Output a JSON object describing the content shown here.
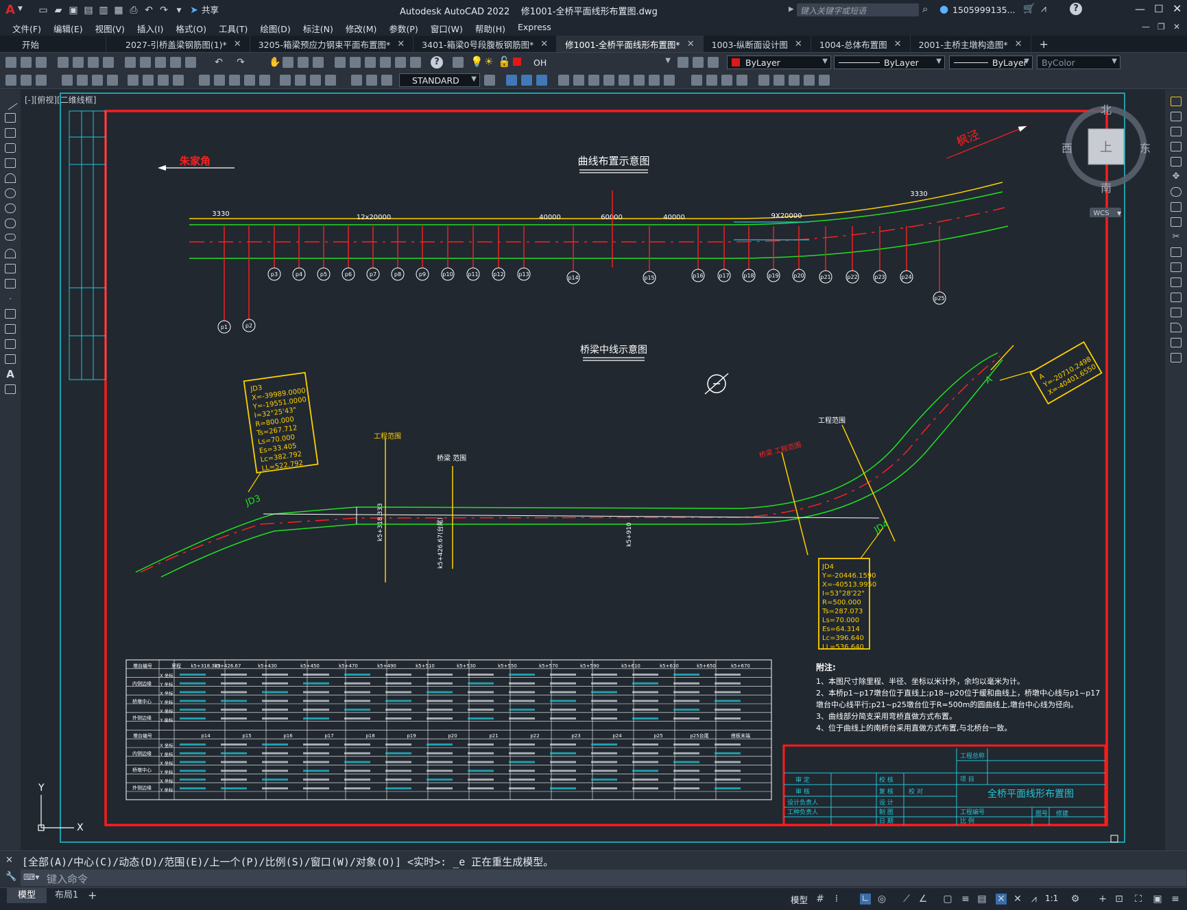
{
  "app": {
    "title": "Autodesk AutoCAD 2022    修1001-全桥平面线形布置图.dwg",
    "share_label": "共享",
    "search_placeholder": "键入关键字或短语",
    "user": "1505999135...",
    "help_icon": "question-icon",
    "window_controls": [
      "minimize-icon",
      "maximize-icon",
      "close-icon"
    ]
  },
  "menu": [
    "文件(F)",
    "编辑(E)",
    "视图(V)",
    "插入(I)",
    "格式(O)",
    "工具(T)",
    "绘图(D)",
    "标注(N)",
    "修改(M)",
    "参数(P)",
    "窗口(W)",
    "帮助(H)",
    "Express"
  ],
  "tabs": [
    {
      "label": "开始",
      "active": false
    },
    {
      "label": "2027-引桥盖梁钢筋图(1)*",
      "active": false
    },
    {
      "label": "3205-箱梁预应力钢束平面布置图*",
      "active": false
    },
    {
      "label": "3401-箱梁0号段腹板钢筋图*",
      "active": false
    },
    {
      "label": "修1001-全桥平面线形布置图*",
      "active": true
    },
    {
      "label": "1003-纵断面设计图",
      "active": false
    },
    {
      "label": "1004-总体布置图",
      "active": false
    },
    {
      "label": "2001-主桥主墩构造图*",
      "active": false
    }
  ],
  "toolbar": {
    "layer": "OH",
    "color": "ByLayer",
    "linetype": "ByLayer",
    "lineweight": "ByLayer",
    "plotstyle": "ByColor",
    "textstyle": "STANDARD"
  },
  "viewport_label": "[-][俯视][二维线框]",
  "viewcube": {
    "north": "北",
    "south": "南",
    "east": "东",
    "west": "西",
    "top": "上",
    "wcs": "WCS"
  },
  "drawing": {
    "left_place": "朱家角",
    "right_place": "枫泾",
    "title_top": "曲线布置示意图",
    "title_mid": "桥梁中线示意图",
    "dims": [
      "3330",
      "12x20000",
      "40000",
      "60000",
      "40000",
      "9X20000",
      "3330"
    ],
    "piers_top": [
      "p3",
      "p4",
      "p5",
      "p6",
      "p7",
      "p8",
      "p9",
      "p10",
      "p11",
      "p12",
      "p13",
      "p14",
      "p15",
      "p16",
      "p17",
      "p18",
      "p19",
      "p20",
      "p21",
      "p22",
      "p23",
      "p24",
      "p25",
      "p1",
      "p2"
    ],
    "jd3": [
      "JD3",
      "X=-39989.0000",
      "Y=-19551.0000",
      "I=32°25'43\"",
      "R=800.000",
      "Ts=267.712",
      "Ls=70.000",
      "Es=33.405",
      "Lc=382.792",
      "LL=522.792"
    ],
    "jd4": [
      "JD4",
      "Y=-20446.1590",
      "X=-40513.9950",
      "I=53°28'22\"",
      "R=500.000",
      "Ts=287.073",
      "Ls=70.000",
      "Es=64.314",
      "Lc=396.640",
      "LL=536.640"
    ],
    "point_a": [
      "A",
      "Y=-20710.2498",
      "X=-40401.6550"
    ],
    "labels": [
      "工程范围",
      "桥梁 范围",
      "工程范围",
      "桥梁 工程范围",
      "JD3",
      "JD4",
      "A",
      "k5+318.333",
      "k5+426.67(台尾)",
      "k5+910"
    ],
    "notes_title": "附注:",
    "notes": [
      "1、本图尺寸除里程、半径、坐标以米计外，余均以毫米为计。",
      "2、本桥p1~p17墩台位于直线上;p18~p20位于缓和曲线上，桥墩中心线与p1~p17",
      "   墩台中心线平行;p21~p25墩台位于R=500m的圆曲线上,墩台中心线为径向。",
      "3、曲线部分简支采用弯桥直做方式布置。",
      "4、位于曲线上的南桥台采用直做方式布置,与北桥台一致。"
    ],
    "titleblock": {
      "drawing_name": "全桥平面线形布置图",
      "cells": [
        "工程总称",
        "项  目",
        "审  定",
        "审  核",
        "设计负责人",
        "工种负责人",
        "校  核",
        "复  核",
        "设  计",
        "制  图",
        "日  期",
        "校  对",
        "图号",
        "修建",
        "工程编号",
        "比  例"
      ]
    },
    "table_header1": [
      "墩台编号",
      "里程",
      "k5+318.333",
      "k5+426.67",
      "k5+430",
      "k5+450",
      "k5+470",
      "k5+490",
      "k5+510",
      "k5+530",
      "k5+550",
      "k5+570",
      "k5+590",
      "k5+610",
      "k5+630",
      "k5+650",
      "k5+670"
    ],
    "table_header2": [
      "墩台编号",
      "p14",
      "p15",
      "p16",
      "p17",
      "p18",
      "p19",
      "p20",
      "p21",
      "p22",
      "p23",
      "p24",
      "p25",
      "p25台尾",
      "搭板末端"
    ],
    "table_rows": [
      "内侧边缘",
      "桥墩中心",
      "外侧边缘",
      "X 坐标",
      "Y 坐标"
    ]
  },
  "command": {
    "history": "[全部(A)/中心(C)/动态(D)/范围(E)/上一个(P)/比例(S)/窗口(W)/对象(O)] <实时>: _e 正在重生成模型。",
    "placeholder": "键入命令"
  },
  "status": {
    "tabs": [
      "模型",
      "布局1"
    ],
    "model_button": "模型",
    "scale": "1:1"
  }
}
